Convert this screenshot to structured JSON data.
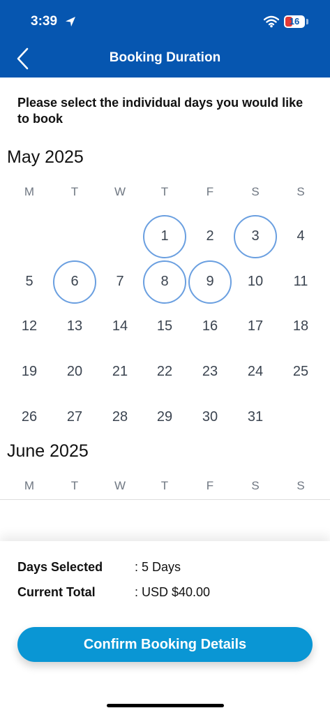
{
  "status_bar": {
    "time": "3:39",
    "battery": "16"
  },
  "nav": {
    "title": "Booking Duration"
  },
  "instruction": "Please select the individual days you would like to book",
  "calendar": {
    "weekdays": [
      "M",
      "T",
      "W",
      "T",
      "F",
      "S",
      "S"
    ],
    "may": {
      "title": "May 2025",
      "days": [
        "1",
        "2",
        "3",
        "4",
        "5",
        "6",
        "7",
        "8",
        "9",
        "10",
        "11",
        "12",
        "13",
        "14",
        "15",
        "16",
        "17",
        "18",
        "19",
        "20",
        "21",
        "22",
        "23",
        "24",
        "25",
        "26",
        "27",
        "28",
        "29",
        "30",
        "31"
      ],
      "selected": [
        "1",
        "3",
        "6",
        "8",
        "9"
      ]
    },
    "june": {
      "title": "June 2025"
    }
  },
  "summary": {
    "days_label": "Days Selected",
    "days_value": ": 5 Days",
    "total_label": "Current Total",
    "total_value": ": USD $40.00"
  },
  "confirm_label": "Confirm Booking Details",
  "colors": {
    "header": "#0656b0",
    "button": "#0a96d4",
    "selection_ring": "#6a9fe0"
  }
}
